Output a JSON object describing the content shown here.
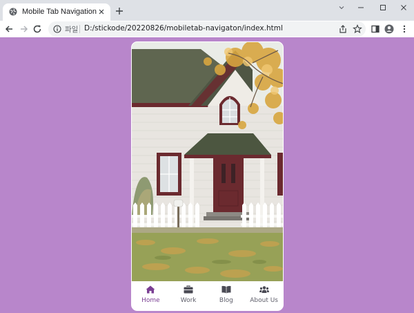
{
  "browser": {
    "tab": {
      "title": "Mobile Tab Navigation",
      "favicon": "globe-icon"
    },
    "controls": [
      "new-tab-icon",
      "chevron-down-icon",
      "minimize-icon",
      "maximize-icon",
      "close-icon"
    ],
    "toolbar": {
      "scheme_label": "파일",
      "url": "D:/stickode/20220826/mobiletab-navigaton/index.html",
      "icons": [
        "back-icon",
        "forward-icon",
        "reload-icon",
        "info-icon",
        "share-icon",
        "star-icon",
        "sidepanel-icon",
        "profile-icon",
        "menu-icon"
      ]
    }
  },
  "page": {
    "background_color": "#b886cb",
    "accent_color": "#7a3e93",
    "hero_image": "white-house-autumn-photo",
    "nav": {
      "active_index": 0,
      "items": [
        {
          "label": "Home",
          "icon": "home-icon"
        },
        {
          "label": "Work",
          "icon": "briefcase-icon"
        },
        {
          "label": "Blog",
          "icon": "book-icon"
        },
        {
          "label": "About Us",
          "icon": "users-icon"
        }
      ]
    }
  }
}
